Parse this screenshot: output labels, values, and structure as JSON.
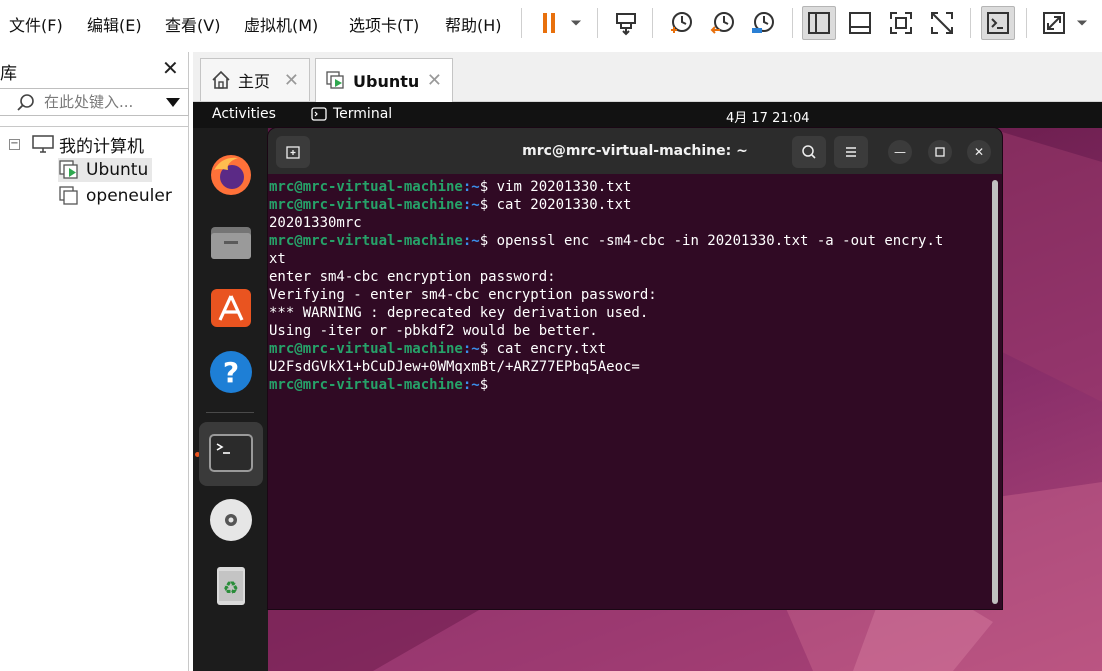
{
  "menu": [
    "文件(F)",
    "编辑(E)",
    "查看(V)",
    "虚拟机(M)",
    "选项卡(T)",
    "帮助(H)"
  ],
  "toolbar": {
    "icons": [
      "pause-icon",
      "send-keys-icon",
      "snapshot-icon",
      "revert-snapshot-icon",
      "manage-snapshots-icon",
      "sidebar-view-icon",
      "thumbnail-view-icon",
      "fullscreen-icon",
      "unity-icon",
      "console-icon",
      "stretch-icon"
    ],
    "accent": "#e8700c"
  },
  "library": {
    "title": "库",
    "search_placeholder": "在此处键入...",
    "tree": {
      "root": "我的计算机",
      "items": [
        "Ubuntu",
        "openeuler"
      ]
    }
  },
  "tabs": [
    {
      "label": "主页"
    },
    {
      "label": "Ubuntu"
    }
  ],
  "gnome": {
    "activities": "Activities",
    "app_name": "Terminal",
    "clock": "4月 17  21:04"
  },
  "terminal": {
    "title": "mrc@mrc-virtual-machine: ~",
    "prompt_user": "mrc@mrc-virtual-machine",
    "prompt_path": ":~",
    "lines": [
      {
        "prompt": true,
        "text": "$ vim 20201330.txt"
      },
      {
        "prompt": true,
        "text": "$ cat 20201330.txt"
      },
      {
        "prompt": false,
        "text": "20201330mrc"
      },
      {
        "prompt": true,
        "text": "$ openssl enc -sm4-cbc -in 20201330.txt -a -out encry.t"
      },
      {
        "prompt": false,
        "text": "xt"
      },
      {
        "prompt": false,
        "text": "enter sm4-cbc encryption password:"
      },
      {
        "prompt": false,
        "text": "Verifying - enter sm4-cbc encryption password:"
      },
      {
        "prompt": false,
        "text": "*** WARNING : deprecated key derivation used."
      },
      {
        "prompt": false,
        "text": "Using -iter or -pbkdf2 would be better."
      },
      {
        "prompt": true,
        "text": "$ cat encry.txt"
      },
      {
        "prompt": false,
        "text": "U2FsdGVkX1+bCuDJew+0WMqxmBt/+ARZ77EPbq5Aeoc="
      },
      {
        "prompt": true,
        "text": "$ "
      }
    ],
    "colors": {
      "background": "#300a24",
      "user": "#26a269",
      "path": "#3b8eea"
    }
  },
  "dock": [
    "firefox-icon",
    "files-icon",
    "software-icon",
    "help-icon",
    "terminal-icon",
    "dvd-icon",
    "trash-icon"
  ]
}
